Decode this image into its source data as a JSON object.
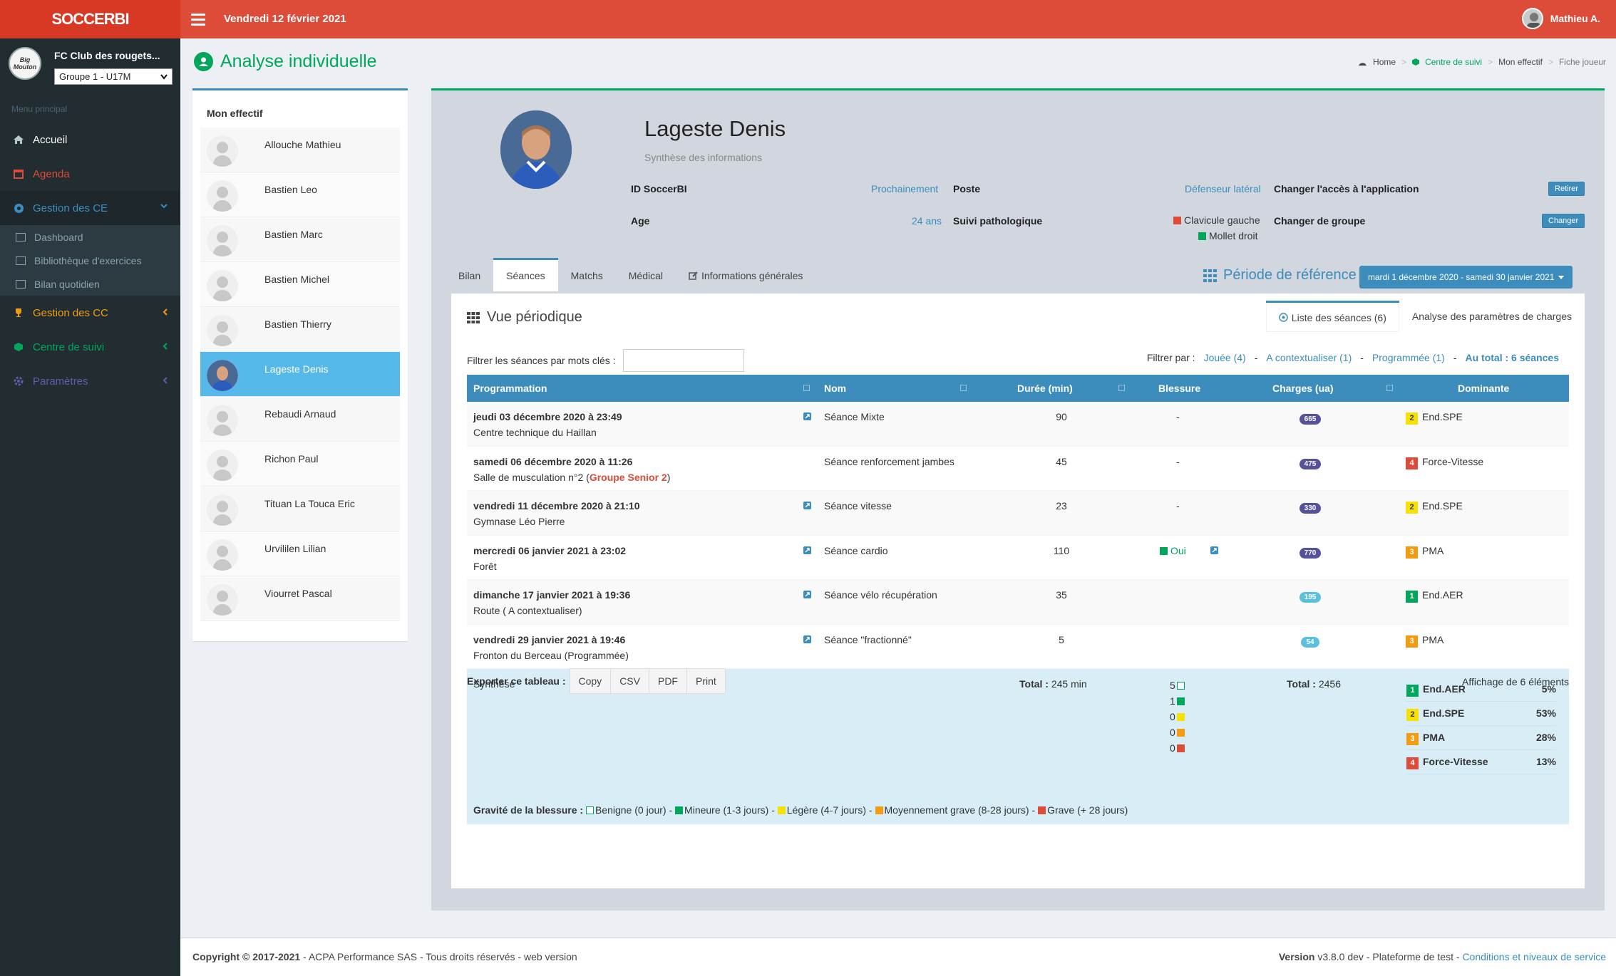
{
  "app": {
    "logo": "SOCCERBI",
    "date": "Vendredi 12 février 2021",
    "user": "Mathieu A."
  },
  "sidebar": {
    "club_logo": "Big Mouton",
    "club": "FC Club des rougets...",
    "group": "Groupe 1 - U17M",
    "menu_label": "Menu principal",
    "items": [
      {
        "label": "Accueil",
        "color": "#ffffff"
      },
      {
        "label": "Agenda",
        "color": "#dd4b39"
      },
      {
        "label": "Gestion des CE",
        "color": "#3c8dbc"
      },
      {
        "label": "Gestion des CC",
        "color": "#f39c12"
      },
      {
        "label": "Centre de suivi",
        "color": "#00a65a"
      },
      {
        "label": "Paramètres",
        "color": "#605ca8"
      }
    ],
    "subitems": [
      "Dashboard",
      "Bibliothèque d'exercices",
      "Bilan quotidien"
    ]
  },
  "page": {
    "title": "Analyse individuelle"
  },
  "breadcrumb": [
    "Home",
    "Centre de suivi",
    "Mon effectif",
    "Fiche joueur"
  ],
  "effectif": {
    "title": "Mon effectif",
    "players": [
      "Allouche Mathieu",
      "Bastien Leo",
      "Bastien Marc",
      "Bastien Michel",
      "Bastien Thierry",
      "Lageste Denis",
      "Rebaudi Arnaud",
      "Richon Paul",
      "Tituan La Touca Eric",
      "Urvililen Lilian",
      "Viourret Pascal"
    ],
    "active_index": 5
  },
  "player": {
    "name": "Lageste Denis",
    "subtitle": "Synthèse des informations",
    "id_label": "ID SoccerBI",
    "id_value": "Prochainement",
    "age_label": "Age",
    "age_value": "24 ans",
    "poste_label": "Poste",
    "poste_value": "Défenseur latéral",
    "suivi_label": "Suivi pathologique",
    "suivi_1": "Clavicule gauche",
    "suivi_2": "Mollet droit",
    "acces_label": "Changer l'accès à l'application",
    "acces_btn": "Retirer",
    "groupe_label": "Changer de groupe",
    "groupe_btn": "Changer"
  },
  "tabs": [
    "Bilan",
    "Séances",
    "Matchs",
    "Médical",
    "Informations générales"
  ],
  "periode": {
    "label": "Période de référence",
    "value": "mardi 1 décembre 2020 - samedi 30 janvier 2021"
  },
  "vue": {
    "title": "Vue périodique",
    "subtabs": [
      "Liste des séances (6)",
      "Analyse des paramètres de charges"
    ],
    "filter_label": "Filtrer les séances par mots clés :",
    "filter_by": "Filtrer par :",
    "filters": [
      "Jouée (4)",
      "A contextualiser (1)",
      "Programmée (1)"
    ],
    "total": "Au total : 6 séances"
  },
  "table": {
    "headers": [
      "Programmation",
      "Nom",
      "Durée (min)",
      "Blessure",
      "Charges (ua)",
      "Dominante"
    ],
    "rows": [
      {
        "date": "jeudi 03 décembre 2020 à 23:49",
        "lieu": "Centre technique du Haillan",
        "nom": "Séance Mixte",
        "duree": "90",
        "blessure": "-",
        "charge": "665",
        "cc": "#555299",
        "dn": "2",
        "dc": "#f6e100",
        "dom": "End.SPE"
      },
      {
        "date": "samedi 06 décembre 2020 à 11:26",
        "lieu": "Salle de musculation n°2 (",
        "lieu_extra": "Groupe Senior 2",
        "lieu_end": ")",
        "nom": "Séance renforcement jambes",
        "duree": "45",
        "blessure": "-",
        "charge": "475",
        "cc": "#555299",
        "dn": "4",
        "dc": "#dd4b39",
        "dom": "Force-Vitesse"
      },
      {
        "date": "vendredi 11 décembre 2020 à 21:10",
        "lieu": "Gymnase Léo Pierre",
        "nom": "Séance vitesse",
        "duree": "23",
        "blessure": "-",
        "charge": "330",
        "cc": "#555299",
        "dn": "2",
        "dc": "#f6e100",
        "dom": "End.SPE"
      },
      {
        "date": "mercredi 06 janvier 2021 à 23:02",
        "lieu": "Forêt",
        "nom": "Séance cardio",
        "duree": "110",
        "blessure": "Oui",
        "charge": "770",
        "cc": "#555299",
        "dn": "3",
        "dc": "#f39c12",
        "dom": "PMA"
      },
      {
        "date": "dimanche 17 janvier 2021 à 19:36",
        "lieu": "Route ( A contextualiser)",
        "nom": "Séance vélo récupération",
        "duree": "35",
        "blessure": "",
        "charge": "195",
        "cc": "#5bc0de",
        "dn": "1",
        "dc": "#00a65a",
        "dom": "End.AER"
      },
      {
        "date": "vendredi 29 janvier 2021 à 19:46",
        "lieu": "Fronton du Berceau (Programmée)",
        "nom": "Séance \"fractionné\"",
        "duree": "5",
        "blessure": "",
        "charge": "54",
        "cc": "#5bc0de",
        "dn": "3",
        "dc": "#f39c12",
        "dom": "PMA"
      }
    ],
    "synthese": {
      "label": "Synthèse",
      "total_label": "Total :",
      "duree_total": "245 min",
      "charge_total": "2456",
      "counts": [
        "5",
        "1",
        "0",
        "0",
        "0"
      ],
      "dom": [
        {
          "n": "1",
          "c": "#00a65a",
          "label": "End.AER",
          "pct": "5%"
        },
        {
          "n": "2",
          "c": "#f6e100",
          "label": "End.SPE",
          "pct": "53%"
        },
        {
          "n": "3",
          "c": "#f39c12",
          "label": "PMA",
          "pct": "28%"
        },
        {
          "n": "4",
          "c": "#dd4b39",
          "label": "Force-Vitesse",
          "pct": "13%"
        }
      ],
      "gravite_label": "Gravité de la blessure :",
      "gravite": [
        "Benigne (0 jour)",
        "Mineure (1-3 jours)",
        "Légère (4-7 jours)",
        "Moyennement grave (8-28 jours)",
        "Grave (+ 28 jours)"
      ]
    }
  },
  "export": {
    "label": "Exporter ce tableau :",
    "buttons": [
      "Copy",
      "CSV",
      "PDF",
      "Print"
    ],
    "info": "Affichage de 6 éléments"
  },
  "footer": {
    "copyright": "Copyright © 2017-2021",
    "company": " - ACPA Performance SAS - Tous droits réservés - web version",
    "version_label": "Version",
    "version": " v3.8.0 dev - Plateforme de test - ",
    "link": "Conditions et niveaux de service"
  }
}
